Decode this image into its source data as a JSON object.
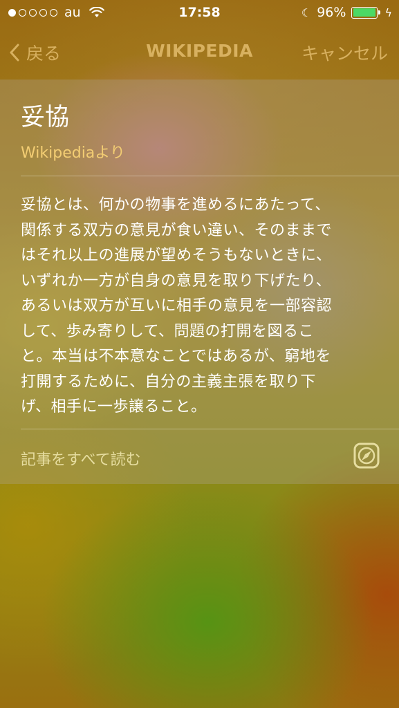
{
  "status_bar": {
    "signal_strength": 1,
    "signal_max": 5,
    "carrier": "au",
    "time": "17:58",
    "battery_percent": "96%",
    "battery_level": 0.96,
    "battery_color": "#4cd964"
  },
  "nav": {
    "back_label": "戻る",
    "title": "WIKIPEDIA",
    "cancel_label": "キャンセル",
    "accent_color": "#d8b160"
  },
  "article": {
    "title": "妥協",
    "source": "Wikipediaより",
    "body": "妥協とは、何かの物事を進めるにあたって、\n関係する双方の意見が食い違い、そのままで\nはそれ以上の進展が望めそうもないときに、\nいずれか一方が自身の意見を取り下げたり、\nあるいは双方が互いに相手の意見を一部容認\nして、歩み寄りして、問題の打開を図るこ\nと。本当は不本意なことではあるが、窮地を\n打開するために、自分の主義主張を取り下\nげ、相手に一歩譲ること。",
    "read_more": "記事をすべて読む",
    "open_icon": "safari-compass-icon"
  }
}
